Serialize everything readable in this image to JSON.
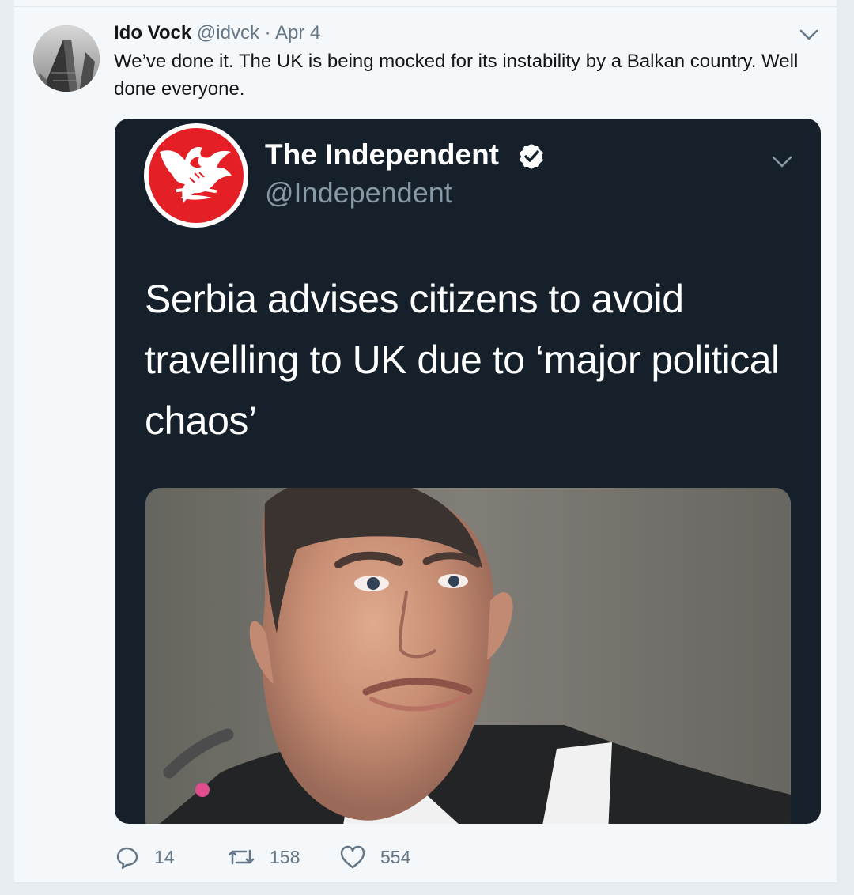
{
  "tweet": {
    "user": {
      "name": "Ido Vock",
      "handle": "@idvck",
      "separator": "·",
      "date": "Apr 4"
    },
    "text": "We’ve done it. The UK is being mocked for its instability by a Balkan country. Well done everyone.",
    "menu_icon": "chevron-down-icon"
  },
  "quoted_tweet": {
    "name": "The Independent",
    "handle": "@Independent",
    "verified": true,
    "headline": "Serbia advises citizens to avoid travelling to UK due to ‘major political chaos’",
    "menu_icon": "chevron-down-icon",
    "logo_icon": "eagle-logo-icon",
    "photo_description": "politician-photo"
  },
  "actions": {
    "reply_count": "14",
    "retweet_count": "158",
    "like_count": "554"
  },
  "colors": {
    "page_background": "#e6ecf0",
    "card_background": "#f5f8fa",
    "quote_background": "#15202b",
    "independent_red": "#e42026",
    "secondary_text": "#657786"
  }
}
